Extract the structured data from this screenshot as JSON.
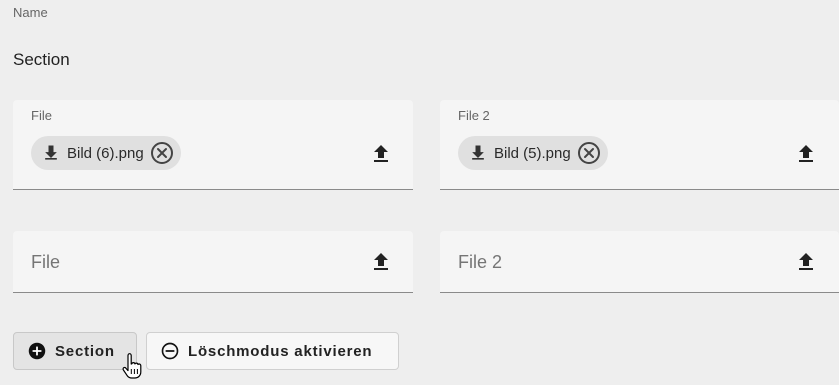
{
  "form": {
    "name_label": "Name",
    "section_title": "Section"
  },
  "rows": [
    {
      "left": {
        "label": "File",
        "chip": "Bild (6).png"
      },
      "right": {
        "label": "File 2",
        "chip": "Bild (5).png"
      }
    },
    {
      "left": {
        "placeholder": "File"
      },
      "right": {
        "placeholder": "File 2"
      }
    }
  ],
  "actions": {
    "add_section_label": "Section",
    "delete_mode_label": "Löschmodus aktivieren"
  },
  "icons": {
    "download": "download-icon",
    "remove": "cancel-circle-icon",
    "upload": "upload-icon",
    "add": "add-circle-icon",
    "remove_mode": "remove-circle-outline-icon",
    "cursor": "hand-pointer-icon"
  },
  "colors": {
    "background": "#eeeeee",
    "field_bg": "#f5f5f5",
    "chip_bg": "#e0e0e0",
    "text": "#222222"
  }
}
